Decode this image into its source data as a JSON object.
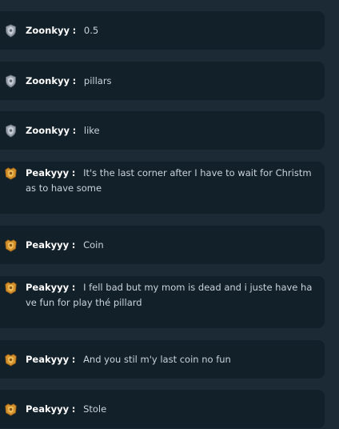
{
  "colors": {
    "background": "#1c2a36",
    "card": "#122029",
    "username": "#ffffff",
    "message_text": "#c9d3dc"
  },
  "separator": ":",
  "messages": [
    {
      "user": "Zoonkyy",
      "badge": "silver-rank-badge-icon",
      "text": "0.5"
    },
    {
      "user": "Zoonkyy",
      "badge": "silver-rank-badge-icon",
      "text": "pillars"
    },
    {
      "user": "Zoonkyy",
      "badge": "silver-rank-badge-icon",
      "text": "like"
    },
    {
      "user": "Peakyyy",
      "badge": "gold-rank-badge-icon",
      "text": "It's the last corner after I have to wait for Christmas to have some"
    },
    {
      "user": "Peakyyy",
      "badge": "gold-rank-badge-icon",
      "text": "Coin"
    },
    {
      "user": "Peakyyy",
      "badge": "gold-rank-badge-icon",
      "text": "I fell bad but my mom is dead and i juste have have fun for play thé pillard"
    },
    {
      "user": "Peakyyy",
      "badge": "gold-rank-badge-icon",
      "text": "And you stil m'y last coin no fun"
    },
    {
      "user": "Peakyyy",
      "badge": "gold-rank-badge-icon",
      "text": "Stole"
    }
  ]
}
